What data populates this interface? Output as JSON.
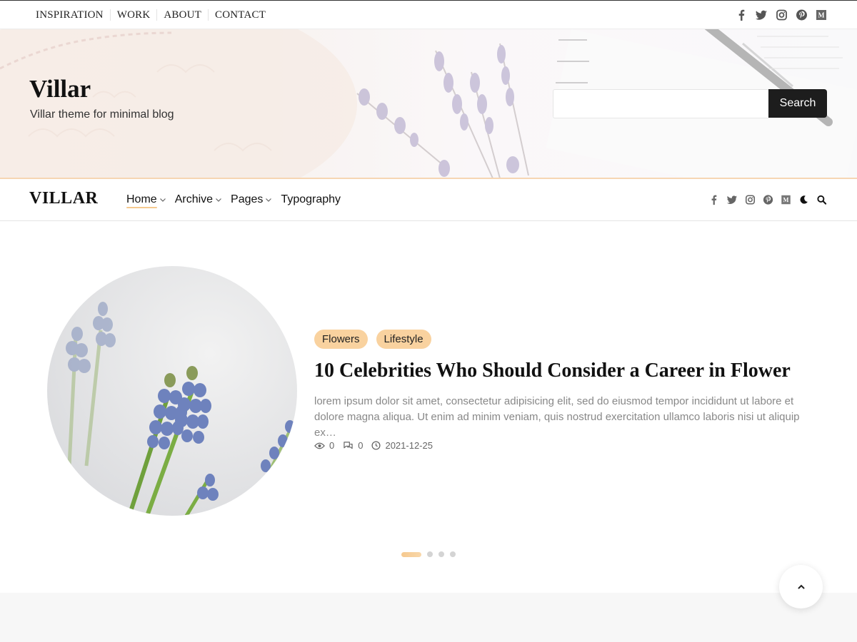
{
  "topbar": {
    "links": [
      "INSPIRATION",
      "WORK",
      "ABOUT",
      "CONTACT"
    ],
    "social_icons": [
      "facebook-icon",
      "twitter-icon",
      "instagram-icon",
      "pinterest-icon",
      "medium-icon"
    ]
  },
  "hero": {
    "site_title": "Villar",
    "tagline": "Villar theme for minimal blog",
    "search_placeholder": "",
    "search_button": "Search"
  },
  "nav": {
    "logo": "VILLAR",
    "menu": [
      {
        "label": "Home",
        "has_dropdown": true,
        "active": true
      },
      {
        "label": "Archive",
        "has_dropdown": true,
        "active": false
      },
      {
        "label": "Pages",
        "has_dropdown": true,
        "active": false
      },
      {
        "label": "Typography",
        "has_dropdown": false,
        "active": false
      }
    ],
    "icons": [
      "facebook-icon",
      "twitter-icon",
      "instagram-icon",
      "pinterest-icon",
      "medium-icon",
      "moon-icon",
      "search-icon"
    ]
  },
  "featured_post": {
    "tags": [
      "Flowers",
      "Lifestyle"
    ],
    "title": "10 Celebrities Who Should Consider a Career in Flower",
    "excerpt": "lorem ipsum dolor sit amet, consectetur adipisicing elit, sed do eiusmod tempor incididunt ut labore et dolore magna aliqua. Ut enim ad minim veniam, quis nostrud exercitation ullamco laboris nisi ut aliquip ex…",
    "views": "0",
    "comments": "0",
    "date": "2021-12-25"
  },
  "slider": {
    "total": 4,
    "active_index": 0
  },
  "colors": {
    "accent": "#f9d29f",
    "dark": "#1d1d1d",
    "muted_text": "#888888"
  }
}
